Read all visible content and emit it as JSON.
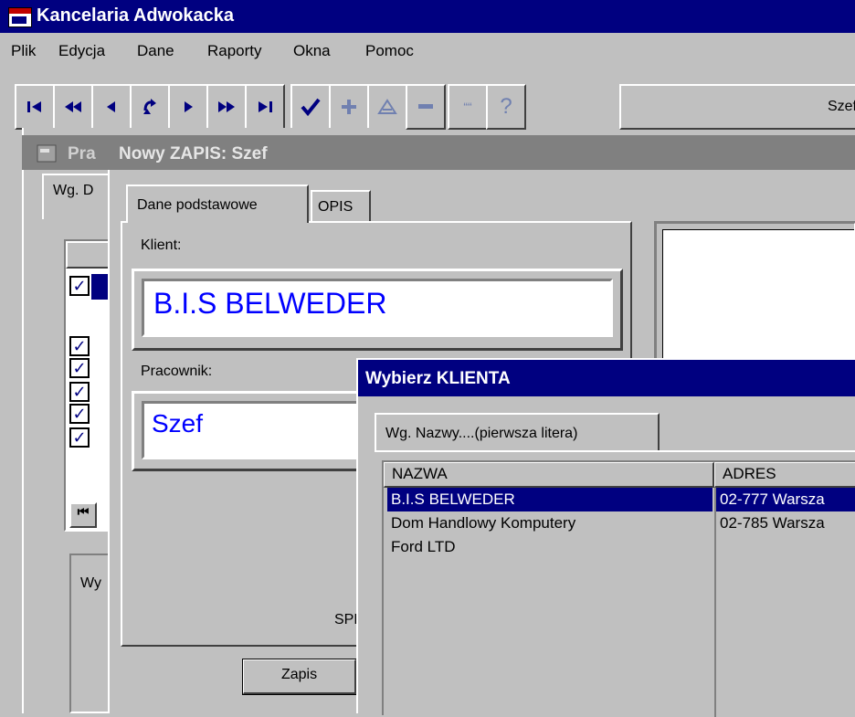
{
  "app": {
    "title": "Kancelaria Adwokacka"
  },
  "menu": [
    "Plik",
    "Edycja",
    "Dane",
    "Raporty",
    "Okna",
    "Pomoc"
  ],
  "toolbar": {
    "user": "Szef"
  },
  "bg_window": {
    "title_fragment": "Pra",
    "tab_fragment": "Wg. D",
    "panel_fragment": "Wy"
  },
  "zapis": {
    "title": "Nowy ZAPIS: Szef",
    "tabs": [
      "Dane podstawowe",
      "OPIS"
    ],
    "client_label": "Klient:",
    "client_value": "B.I.S BELWEDER",
    "employee_label": "Pracownik:",
    "employee_value": "Szef",
    "spr_fragment": "SPF",
    "save_button": "Zapis"
  },
  "dialog": {
    "title": "Wybierz KLIENTA",
    "tab": "Wg. Nazwy....(pierwsza litera)",
    "columns": [
      "NAZWA",
      "ADRES"
    ],
    "rows": [
      {
        "name": "B.I.S BELWEDER",
        "address": "02-777 Warsza"
      },
      {
        "name": "Dom Handlowy Komputery",
        "address": "02-785 Warsza"
      },
      {
        "name": "Ford LTD",
        "address": ""
      }
    ]
  },
  "colors": {
    "titlebar_active": "#000080",
    "titlebar_inactive": "#808080",
    "field_text": "#0000ff",
    "face": "#c0c0c0"
  }
}
